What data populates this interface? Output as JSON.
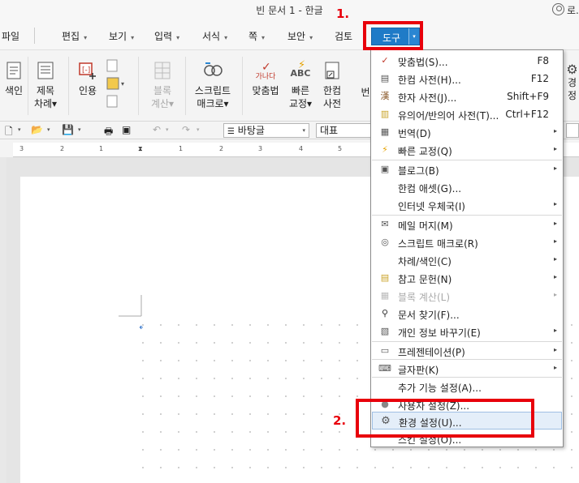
{
  "window": {
    "title": "빈 문서 1 - 한글",
    "user": "로."
  },
  "menubar": {
    "items": [
      {
        "label": "파일",
        "arrow": ""
      },
      {
        "label": "편집",
        "arrow": "▾"
      },
      {
        "label": "보기",
        "arrow": "▾"
      },
      {
        "label": "입력",
        "arrow": "▾"
      },
      {
        "label": "서식",
        "arrow": "▾"
      },
      {
        "label": "쪽",
        "arrow": "▾"
      },
      {
        "label": "보안",
        "arrow": "▾"
      },
      {
        "label": "검토",
        "arrow": ""
      }
    ],
    "tools_label": "도구",
    "tools_arrow": "▾"
  },
  "annotations": {
    "step1": "1.",
    "step2": "2."
  },
  "ribbon": {
    "index_label": "색인",
    "toc_line1": "제목",
    "toc_line2": "차례▾",
    "cite_label": "인용",
    "block_calc_line1": "블록",
    "block_calc_line2": "계산▾",
    "script_line1": "스크립트",
    "script_line2": "매크로▾",
    "spell_label": "맞춤법",
    "spell_icon_text": "가나다",
    "quick_line1": "빠른",
    "quick_line2": "교정▾",
    "quick_icon_text": "ABC",
    "dict_line1": "한컴",
    "dict_line2": "사전",
    "partial_label": "번",
    "env_line1": "경",
    "env_line2": "정"
  },
  "formatbar": {
    "style": "바탕글",
    "font": "대표"
  },
  "ruler": {
    "numbers": [
      "3",
      "2",
      "1",
      "1",
      "2",
      "3",
      "4",
      "5",
      "6"
    ]
  },
  "colors": {
    "accent": "#1f7bc7",
    "highlight": "#e8000b"
  },
  "dropdown": {
    "items": [
      {
        "icon": "spellcheck-icon",
        "glyph": "✓",
        "label": "맞춤법(S)...",
        "shortcut": "F8",
        "sub": ""
      },
      {
        "icon": "dictionary-icon",
        "glyph": "▤",
        "label": "한컴 사전(H)...",
        "shortcut": "F12",
        "sub": ""
      },
      {
        "icon": "hanja-dict-icon",
        "glyph": "漢",
        "label": "한자 사전(J)...",
        "shortcut": "Shift+F9",
        "sub": ""
      },
      {
        "icon": "thesaurus-icon",
        "glyph": "▥",
        "label": "유의어/반의어 사전(T)...",
        "shortcut": "Ctrl+F12",
        "sub": ""
      },
      {
        "icon": "translate-icon",
        "glyph": "▦",
        "label": "번역(D)",
        "shortcut": "",
        "sub": "▸"
      },
      {
        "icon": "quick-correct-icon",
        "glyph": "⚡",
        "label": "빠른 교정(Q)",
        "shortcut": "",
        "sub": "▸"
      },
      {
        "icon": "blog-icon",
        "glyph": "▣",
        "label": "블로그(B)",
        "shortcut": "",
        "sub": "▸"
      },
      {
        "icon": "",
        "glyph": "",
        "label": "한컴 애셋(G)...",
        "shortcut": "",
        "sub": ""
      },
      {
        "icon": "",
        "glyph": "",
        "label": "인터넷 우체국(I)",
        "shortcut": "",
        "sub": "▸"
      },
      {
        "icon": "mail-icon",
        "glyph": "✉",
        "label": "메일 머지(M)",
        "shortcut": "",
        "sub": "▸"
      },
      {
        "icon": "script-macro-icon",
        "glyph": "◎",
        "label": "스크립트 매크로(R)",
        "shortcut": "",
        "sub": "▸"
      },
      {
        "icon": "",
        "glyph": "",
        "label": "차례/색인(C)",
        "shortcut": "",
        "sub": "▸"
      },
      {
        "icon": "reference-icon",
        "glyph": "▤",
        "label": "참고 문헌(N)",
        "shortcut": "",
        "sub": "▸"
      },
      {
        "icon": "block-calc-icon",
        "glyph": "▦",
        "label": "블록 계산(L)",
        "shortcut": "",
        "sub": "▸"
      },
      {
        "icon": "binoculars-icon",
        "glyph": "⚲",
        "label": "문서 찾기(F)...",
        "shortcut": "",
        "sub": ""
      },
      {
        "icon": "privacy-icon",
        "glyph": "▧",
        "label": "개인 정보 바꾸기(E)",
        "shortcut": "",
        "sub": "▸"
      },
      {
        "icon": "presentation-icon",
        "glyph": "▭",
        "label": "프레젠테이션(P)",
        "shortcut": "",
        "sub": "▸"
      },
      {
        "icon": "keyboard-icon",
        "glyph": "⌨",
        "label": "글자판(K)",
        "shortcut": "",
        "sub": "▸"
      },
      {
        "icon": "",
        "glyph": "",
        "label": "추가 기능 설정(A)...",
        "shortcut": "",
        "sub": ""
      },
      {
        "icon": "user-settings-icon",
        "glyph": "●",
        "label": "사용자 설정(Z)...",
        "shortcut": "",
        "sub": ""
      },
      {
        "icon": "gear-icon",
        "glyph": "⚙",
        "label": "환경 설정(U)...",
        "shortcut": "",
        "sub": ""
      },
      {
        "icon": "",
        "glyph": "",
        "label": "스킨 설정(O)...",
        "shortcut": "",
        "sub": ""
      }
    ]
  }
}
